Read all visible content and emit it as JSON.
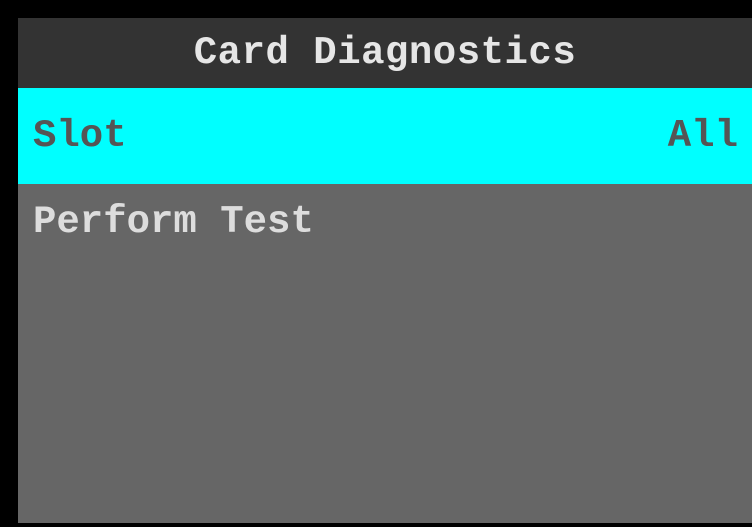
{
  "screen": {
    "title": "Card Diagnostics",
    "items": [
      {
        "label": "Slot",
        "value": "All",
        "selected": true
      },
      {
        "label": "Perform Test",
        "value": "",
        "selected": false
      }
    ]
  },
  "colors": {
    "frame": "#000000",
    "title_bg": "#333333",
    "screen_bg": "#666666",
    "selected_bg": "#00ffff",
    "selected_text": "#555555",
    "normal_text": "#dddddd"
  }
}
